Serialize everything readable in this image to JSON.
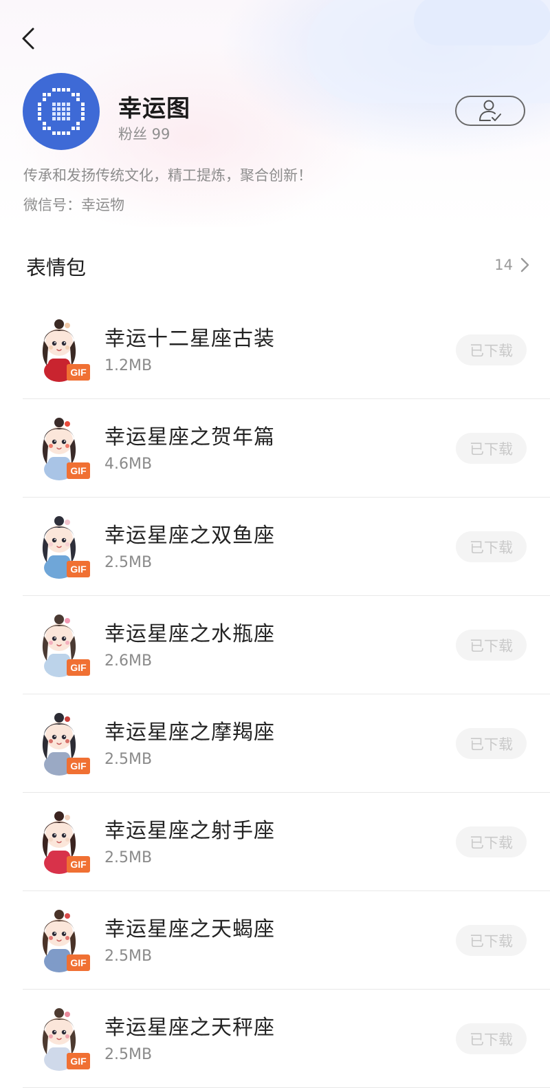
{
  "profile": {
    "name": "幸运图",
    "fans": "粉丝 99",
    "description": "传承和发扬传统文化，精工提炼，聚合创新！",
    "wechat": "微信号：幸运物"
  },
  "section": {
    "title": "表情包",
    "count": "14"
  },
  "colors": {
    "avatar_bg": "#3e6ad6",
    "gif_badge": "#f07033",
    "download_disabled_bg": "#f4f4f4",
    "download_disabled_text": "#c9c9c9"
  },
  "items": [
    {
      "name": "幸运十二星座古装",
      "size": "1.2MB",
      "badge": "GIF",
      "status": "已下载",
      "palette": {
        "hair": "#3b2a24",
        "robe": "#c9242f",
        "accent": "#f0c9a8"
      }
    },
    {
      "name": "幸运星座之贺年篇",
      "size": "4.6MB",
      "badge": "GIF",
      "status": "已下载",
      "palette": {
        "hair": "#3a2b29",
        "robe": "#a9c4e6",
        "accent": "#e94b3c"
      }
    },
    {
      "name": "幸运星座之双鱼座",
      "size": "2.5MB",
      "badge": "GIF",
      "status": "已下载",
      "palette": {
        "hair": "#2e2f3a",
        "robe": "#6fa6d8",
        "accent": "#f3c6cf"
      }
    },
    {
      "name": "幸运星座之水瓶座",
      "size": "2.6MB",
      "badge": "GIF",
      "status": "已下载",
      "palette": {
        "hair": "#4a3a33",
        "robe": "#bcd3ea",
        "accent": "#f19ab3"
      }
    },
    {
      "name": "幸运星座之摩羯座",
      "size": "2.5MB",
      "badge": "GIF",
      "status": "已下载",
      "palette": {
        "hair": "#2c2c34",
        "robe": "#9aa9c4",
        "accent": "#c9403a"
      }
    },
    {
      "name": "幸运星座之射手座",
      "size": "2.5MB",
      "badge": "GIF",
      "status": "已下载",
      "palette": {
        "hair": "#3b2420",
        "robe": "#d8324a",
        "accent": "#f2d3c0"
      }
    },
    {
      "name": "幸运星座之天蝎座",
      "size": "2.5MB",
      "badge": "GIF",
      "status": "已下载",
      "palette": {
        "hair": "#4a3328",
        "robe": "#7f9bc8",
        "accent": "#d94a4a"
      }
    },
    {
      "name": "幸运星座之天秤座",
      "size": "2.5MB",
      "badge": "GIF",
      "status": "已下载",
      "palette": {
        "hair": "#4d3a30",
        "robe": "#cfd9ea",
        "accent": "#e98a9c"
      }
    }
  ]
}
